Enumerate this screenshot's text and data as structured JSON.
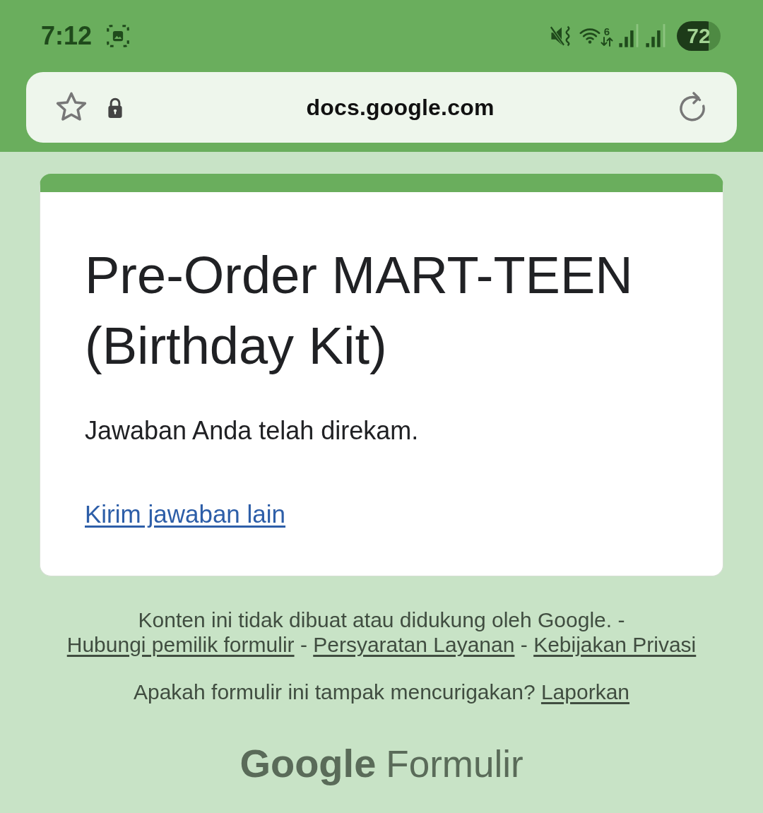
{
  "status_bar": {
    "time": "7:12",
    "wifi_label": "6",
    "battery": "72"
  },
  "address_bar": {
    "url": "docs.google.com"
  },
  "form": {
    "title": "Pre-Order MART-TEEN (Birthday Kit)",
    "message": "Jawaban Anda telah direkam.",
    "link": "Kirim jawaban lain"
  },
  "footer": {
    "disclaimer": [
      {
        "kind": "text",
        "text": "Konten ini tidak dibuat atau didukung oleh Google. -"
      },
      {
        "kind": "link",
        "text": "Hubungi pemilik formulir"
      },
      {
        "kind": "text",
        "text": "-"
      },
      {
        "kind": "link",
        "text": "Persyaratan Layanan"
      },
      {
        "kind": "text",
        "text": "-"
      },
      {
        "kind": "link",
        "text": "Kebijakan Privasi"
      }
    ],
    "report": [
      {
        "kind": "text",
        "text": "Apakah formulir ini tampak mencurigakan?"
      },
      {
        "kind": "link",
        "text": "Laporkan"
      }
    ]
  },
  "logo": {
    "brand": "Google",
    "product": "Formulir"
  }
}
